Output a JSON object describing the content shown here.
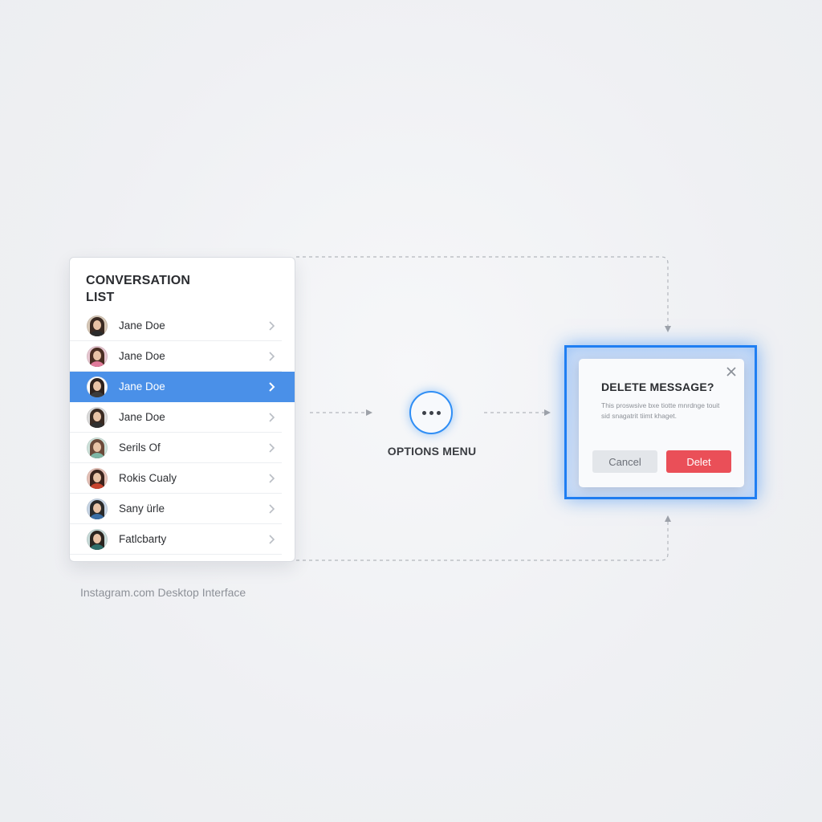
{
  "conversation_list": {
    "title": "CONVERSATION LIST",
    "items": [
      {
        "name": "Jane Doe",
        "selected": false,
        "avatar": {
          "hair": "#3a2a22",
          "shirt": "#2b2b2b",
          "ring": "#d8c9b8"
        }
      },
      {
        "name": "Jane Doe",
        "selected": false,
        "avatar": {
          "hair": "#4a2e23",
          "shirt": "#e07a9a",
          "ring": "#e8c8d2"
        }
      },
      {
        "name": "Jane Doe",
        "selected": true,
        "avatar": {
          "hair": "#2e221c",
          "shirt": "#3b3b3b",
          "ring": "#ffffff"
        }
      },
      {
        "name": "Jane Doe",
        "selected": false,
        "avatar": {
          "hair": "#3a2a22",
          "shirt": "#2f2f2f",
          "ring": "#dcdcdc"
        }
      },
      {
        "name": "Serils Of",
        "selected": false,
        "avatar": {
          "hair": "#6b4a3a",
          "shirt": "#7fb7a6",
          "ring": "#cfe3dc"
        }
      },
      {
        "name": "Rokis Cualy",
        "selected": false,
        "avatar": {
          "hair": "#3c241d",
          "shirt": "#c8452f",
          "ring": "#e6c2b8"
        }
      },
      {
        "name": "Sany ürle",
        "selected": false,
        "avatar": {
          "hair": "#2a2a2a",
          "shirt": "#3a6ea5",
          "ring": "#c8d6e6"
        }
      },
      {
        "name": "Fatlcbarty",
        "selected": false,
        "avatar": {
          "hair": "#2b2520",
          "shirt": "#2f6e6a",
          "ring": "#c9dcda"
        }
      }
    ]
  },
  "caption": "Instagram.com Desktop Interface",
  "options_menu": {
    "label": "OPTIONS MENU",
    "icon": "more-horizontal-icon"
  },
  "dialog": {
    "title": "DELETE MESSAGE?",
    "body": "This proswsive bxe tiotte mnrdnge touit sid snagatrit tiimt khaget.",
    "cancel_label": "Cancel",
    "delete_label": "Delet",
    "close_icon": "close-icon"
  },
  "colors": {
    "accent": "#2f8ef5",
    "selected_row": "#4a90e8",
    "danger": "#ea4f58",
    "frame": "#1f7ef2"
  }
}
